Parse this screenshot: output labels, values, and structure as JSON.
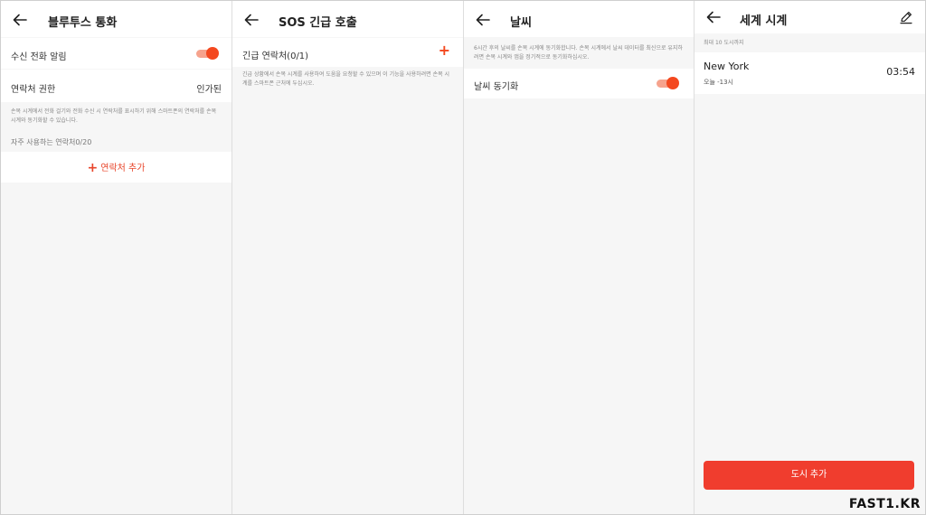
{
  "colors": {
    "accent": "#f4481f",
    "button": "#f03d2e",
    "background": "#f6f6f6"
  },
  "bluetooth": {
    "title": "블루투스 통화",
    "incoming_alert_label": "수신 전화 알림",
    "incoming_alert_on": true,
    "contacts_permission_label": "연락처 권한",
    "contacts_permission_value": "인가된",
    "note": "손목 시계에서 전화 걸기와 전화 수신 시 연락처를 표시하기 위해 스마트폰의 연락처를 손목 시계와 동기화할 수 있습니다.",
    "frequent_label": "자주 사용하는 연락처0/20",
    "add_contact_label": "연락처 추가"
  },
  "sos": {
    "title": "SOS 긴급 호출",
    "contact_label": "긴급 연락처(0/1)",
    "note": "긴급 상황에서 손목 시계를 사용하여 도움을 요청할 수 있으며 이 기능을 사용하려면 손목 시계를 스마트폰 근처에 두십시오."
  },
  "weather": {
    "title": "날씨",
    "note": "6시간 후의 날씨를 손목 시계에 동기화합니다. 손목 시계에서 날씨 데이터를 최신으로 유지하려면 손목 시계와 앱을 정기적으로 동기화하십시오.",
    "sync_label": "날씨 동기화",
    "sync_on": true
  },
  "world_clock": {
    "title": "세계 시계",
    "max_note": "최대 10 도시까지",
    "cities": [
      {
        "name": "New York",
        "sub": "오늘 -13시",
        "time": "03:54"
      }
    ],
    "add_city_label": "도시 추가"
  },
  "watermark": "FAST1.KR"
}
